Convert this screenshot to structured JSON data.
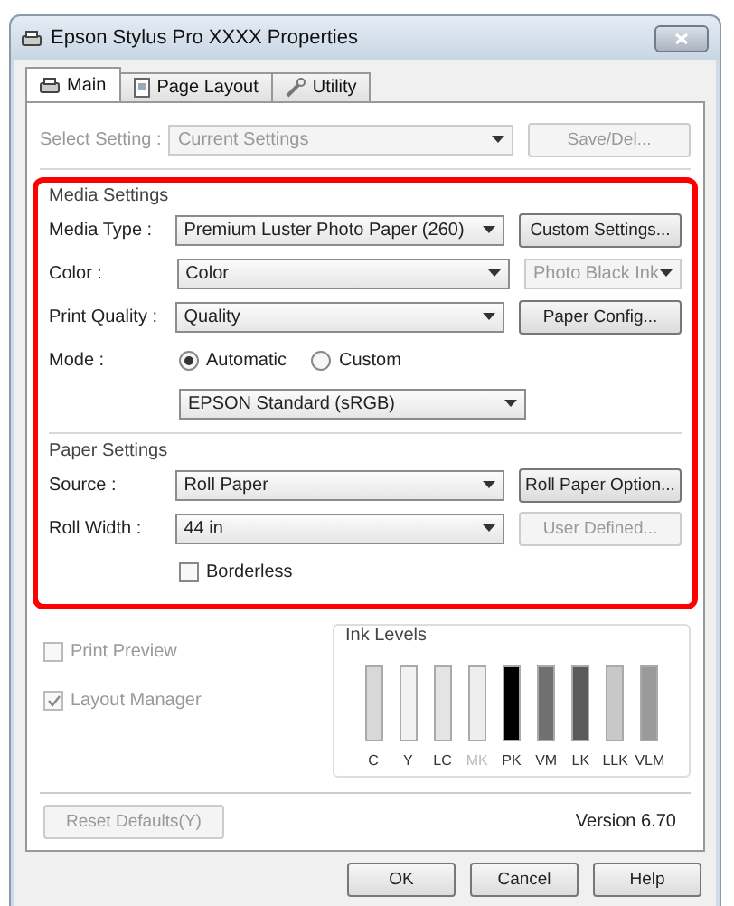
{
  "window": {
    "title": "Epson Stylus Pro XXXX Properties"
  },
  "tabs": [
    {
      "label": "Main",
      "selected": true
    },
    {
      "label": "Page Layout",
      "selected": false
    },
    {
      "label": "Utility",
      "selected": false
    }
  ],
  "select_setting": {
    "label": "Select Setting :",
    "value": "Current Settings",
    "disabled": true,
    "button": {
      "label": "Save/Del...",
      "disabled": true
    }
  },
  "media_settings": {
    "title": "Media Settings",
    "rows": [
      {
        "label": "Media Type :",
        "value": "Premium Luster Photo Paper (260)",
        "side": {
          "kind": "button",
          "label": "Custom Settings...",
          "disabled": false
        }
      },
      {
        "label": "Color :",
        "value": "Color",
        "side": {
          "kind": "dropdown",
          "label": "Photo Black Ink",
          "disabled": true
        }
      },
      {
        "label": "Print Quality :",
        "value": "Quality",
        "side": {
          "kind": "button",
          "label": "Paper Config...",
          "disabled": false
        }
      }
    ],
    "mode": {
      "label": "Mode :",
      "options": [
        {
          "label": "Automatic",
          "selected": true
        },
        {
          "label": "Custom",
          "selected": false
        }
      ],
      "value": "EPSON Standard (sRGB)"
    }
  },
  "paper_settings": {
    "title": "Paper Settings",
    "rows": [
      {
        "label": "Source :",
        "value": "Roll Paper",
        "side": {
          "kind": "button",
          "label": "Roll Paper Option...",
          "disabled": false
        }
      },
      {
        "label": "Roll Width :",
        "value": "44 in",
        "side": {
          "kind": "button",
          "label": "User Defined...",
          "disabled": true
        }
      }
    ],
    "borderless": {
      "label": "Borderless",
      "checked": false
    }
  },
  "options": [
    {
      "label": "Print Preview",
      "checked": false,
      "disabled": true
    },
    {
      "label": "Layout Manager",
      "checked": true,
      "disabled": true
    }
  ],
  "ink_levels": {
    "title": "Ink Levels",
    "inks": [
      {
        "label": "C",
        "color": "#d8d8d8",
        "level": 1,
        "disabled": false
      },
      {
        "label": "Y",
        "color": "#f2f2f2",
        "level": 1,
        "disabled": false
      },
      {
        "label": "LC",
        "color": "#e4e4e4",
        "level": 1,
        "disabled": false
      },
      {
        "label": "MK",
        "color": "#eeeeee",
        "level": 1,
        "disabled": true
      },
      {
        "label": "PK",
        "color": "#000000",
        "level": 1,
        "disabled": false
      },
      {
        "label": "VM",
        "color": "#707070",
        "level": 1,
        "disabled": false
      },
      {
        "label": "LK",
        "color": "#5a5a5a",
        "level": 1,
        "disabled": false
      },
      {
        "label": "LLK",
        "color": "#c8c8c8",
        "level": 1,
        "disabled": false
      },
      {
        "label": "VLM",
        "color": "#9a9a9a",
        "level": 1,
        "disabled": false
      }
    ]
  },
  "reset_button": {
    "label": "Reset Defaults(Y)",
    "disabled": true
  },
  "version": "Version 6.70",
  "buttons": [
    {
      "label": "OK"
    },
    {
      "label": "Cancel"
    },
    {
      "label": "Help"
    }
  ]
}
